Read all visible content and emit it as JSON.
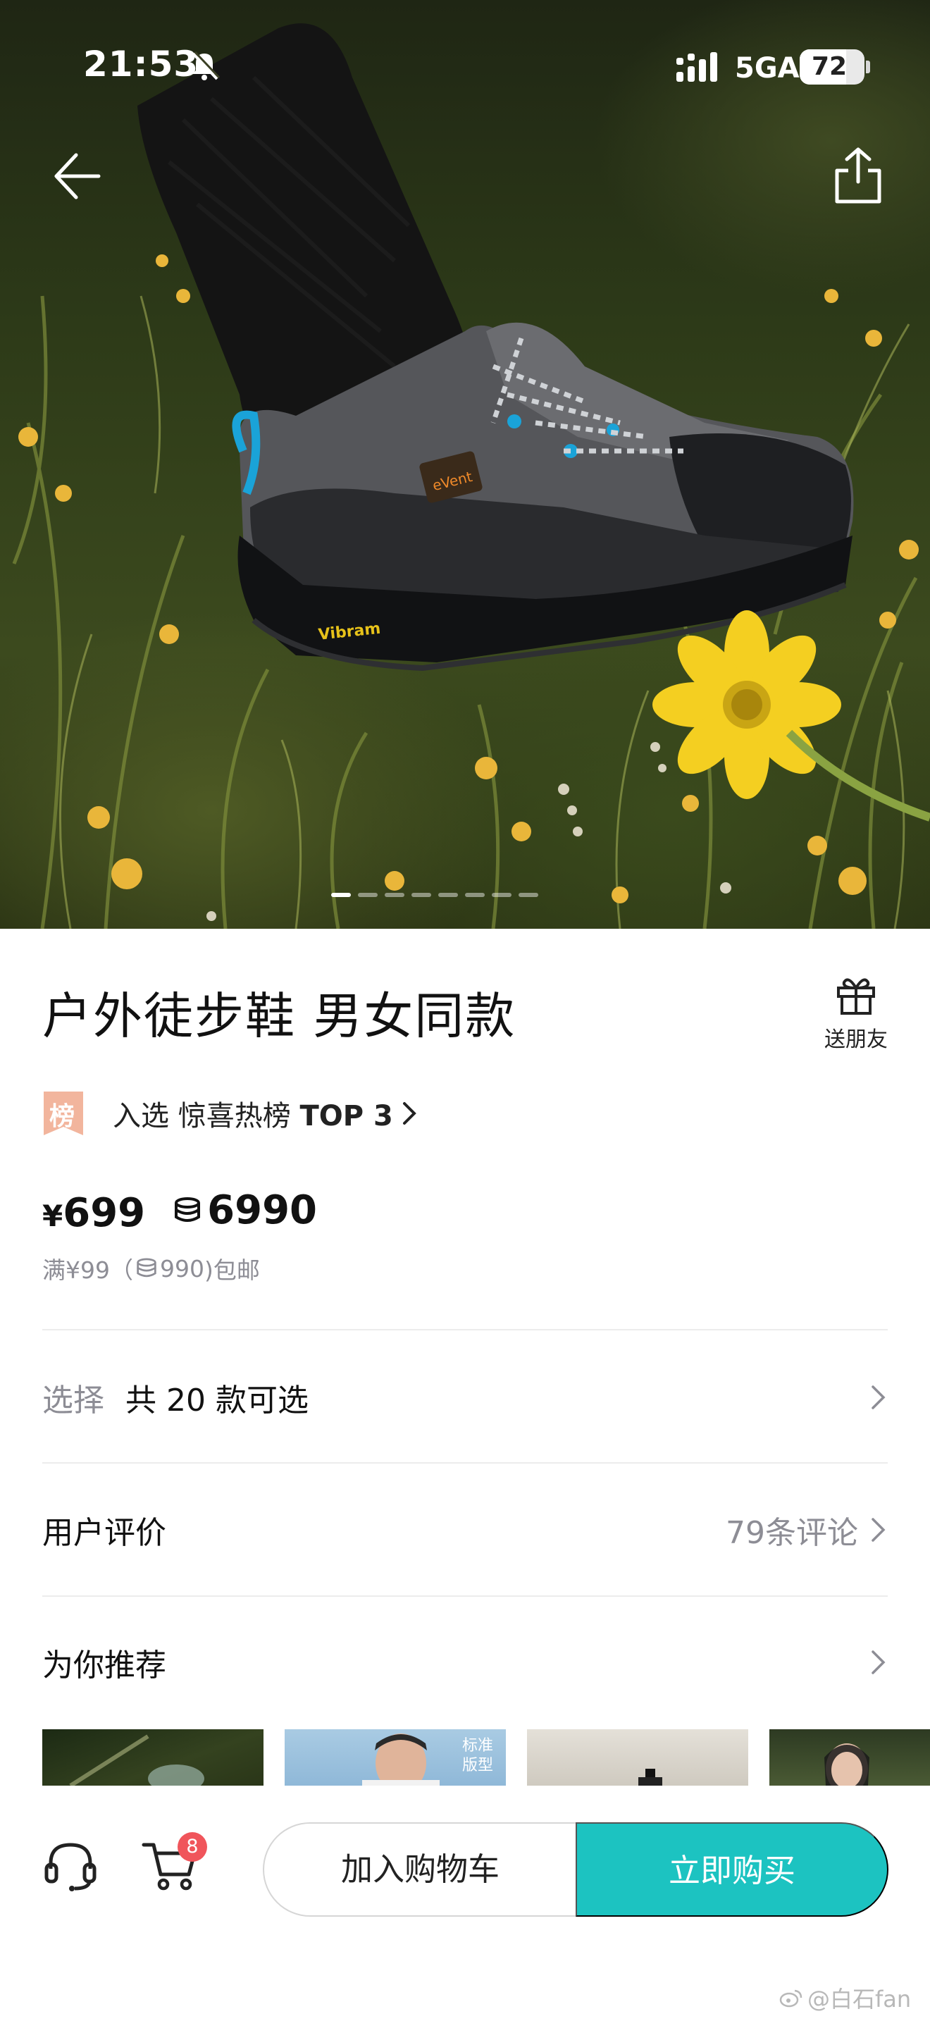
{
  "status_bar": {
    "time": "21:53",
    "network": "5GA",
    "battery_level": "72",
    "battery_fraction": 0.72,
    "icons": [
      "bell-muted-icon",
      "signal-icon",
      "battery-icon"
    ]
  },
  "hero": {
    "image_count": 8,
    "active_index": 0,
    "shoe_brand_label": "eVent",
    "sole_label": "Vibram",
    "icons": [
      "back-arrow-icon",
      "share-icon"
    ]
  },
  "product": {
    "title": "户外徒步鞋 男女同款",
    "gift_label": "送朋友",
    "rank_badge": "榜",
    "rank_text_prefix": "入选 惊喜热榜 ",
    "rank_text_bold": "TOP 3",
    "price_symbol": "¥",
    "price_value": "699",
    "coin_price": "6990",
    "shipping_prefix": "满¥99（",
    "shipping_coin": "990",
    "shipping_suffix": ")包邮"
  },
  "rows": {
    "select_label": "选择",
    "select_value": "共 20 款可选",
    "reviews_label": "用户评价",
    "reviews_count": "79条评论",
    "recommend_label": "为你推荐"
  },
  "recommend": {
    "tag_line1": "标准",
    "tag_line2": "版型"
  },
  "bottom_bar": {
    "cart_badge": "8",
    "add_to_cart": "加入购物车",
    "buy_now": "立即购买"
  },
  "watermark": "@白石fan",
  "colors": {
    "accent": "#1cc3c1",
    "badge_red": "#f0555b",
    "muted_text": "#8d8d95",
    "rank_badge": "#f2b59d"
  }
}
